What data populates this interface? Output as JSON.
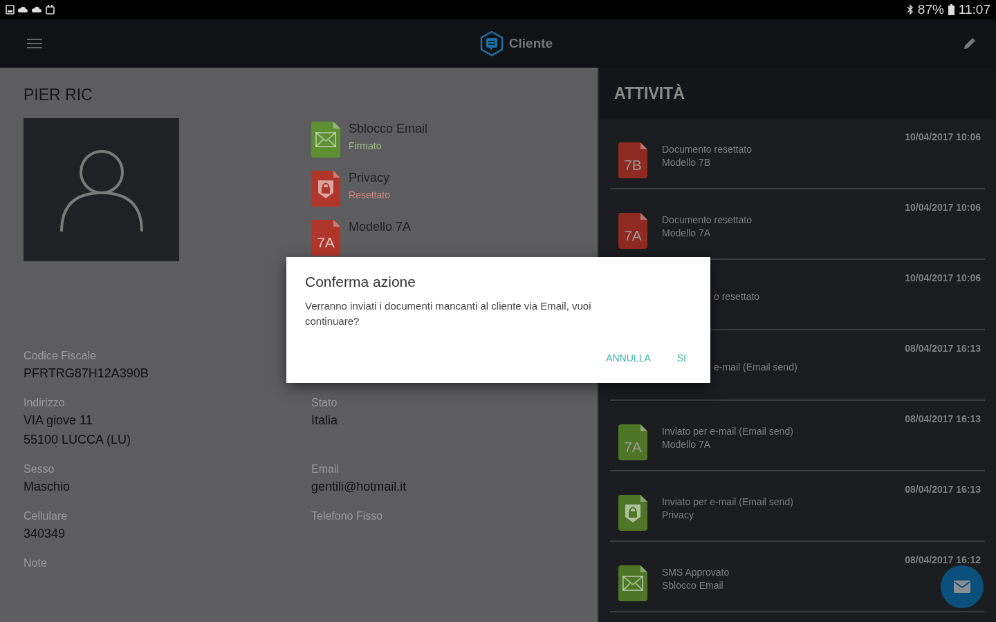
{
  "status_bar": {
    "battery": "87%",
    "time": "11:07"
  },
  "app_bar": {
    "title": "Cliente"
  },
  "customer": {
    "name": "PIER RIC",
    "documents": [
      {
        "title": "Sblocco Email",
        "status": "Firmato",
        "color": "#5f8f33",
        "kind": "mail"
      },
      {
        "title": "Privacy",
        "status": "Resettato",
        "color": "#b0362b",
        "kind": "lock"
      },
      {
        "title": "Modello 7A",
        "color": "#b0362b",
        "kind": "badge",
        "badge": "7A"
      }
    ],
    "field_rows": [
      {
        "left": {
          "label": "Codice Fiscale",
          "value": [
            "PFRTRG87H12A390B"
          ]
        }
      },
      {
        "left": {
          "label": "Indirizzo",
          "value": [
            "VIA giove 11",
            "55100 LUCCA (LU)"
          ]
        },
        "right": {
          "label": "Stato",
          "value": [
            "Italia"
          ]
        }
      },
      {
        "left": {
          "label": "Sesso",
          "value": [
            "Maschio"
          ]
        },
        "right": {
          "label": "Email",
          "value": [
            "gentili@hotmail.it"
          ]
        }
      },
      {
        "left": {
          "label": "Cellulare",
          "value": [
            "340349"
          ]
        },
        "right": {
          "label": "Telefono Fisso"
        }
      },
      {
        "left": {
          "label": "Note"
        }
      }
    ]
  },
  "activity": {
    "title": "ATTIVITÀ",
    "rows": [
      {
        "kind": "badge",
        "date": "10/04/2017 10:06",
        "color": "#8e2a22",
        "badge": "7B",
        "lines": [
          "Documento resettato",
          "Modello 7B"
        ]
      },
      {
        "kind": "badge",
        "date": "10/04/2017 10:06",
        "color": "#8e2a22",
        "badge": "7A",
        "lines": [
          "Documento resettato",
          "Modello 7A"
        ]
      },
      {
        "kind": "partial",
        "date": "10/04/2017 10:06",
        "lines": [
          "o resettato"
        ]
      },
      {
        "kind": "partial",
        "date": "08/04/2017 16:13",
        "lines": [
          "e-mail (Email send)"
        ]
      },
      {
        "kind": "badge",
        "date": "08/04/2017 16:13",
        "color": "#4f7526",
        "badge": "7A",
        "lines": [
          "Inviato per e-mail (Email send)",
          "Modello 7A"
        ]
      },
      {
        "kind": "lock",
        "date": "08/04/2017 16:13",
        "color": "#4f7526",
        "lines": [
          "Inviato per e-mail (Email send)",
          "Privacy"
        ]
      },
      {
        "kind": "mail",
        "date": "08/04/2017 16:12",
        "color": "#4f7526",
        "lines": [
          "SMS Approvato",
          "Sblocco Email"
        ]
      }
    ]
  },
  "dialog": {
    "title": "Conferma azione",
    "message": "Verranno inviati i documenti mancanti al cliente via Email, vuoi continuare?",
    "buttons": [
      "ANNULLA",
      "SI"
    ]
  }
}
